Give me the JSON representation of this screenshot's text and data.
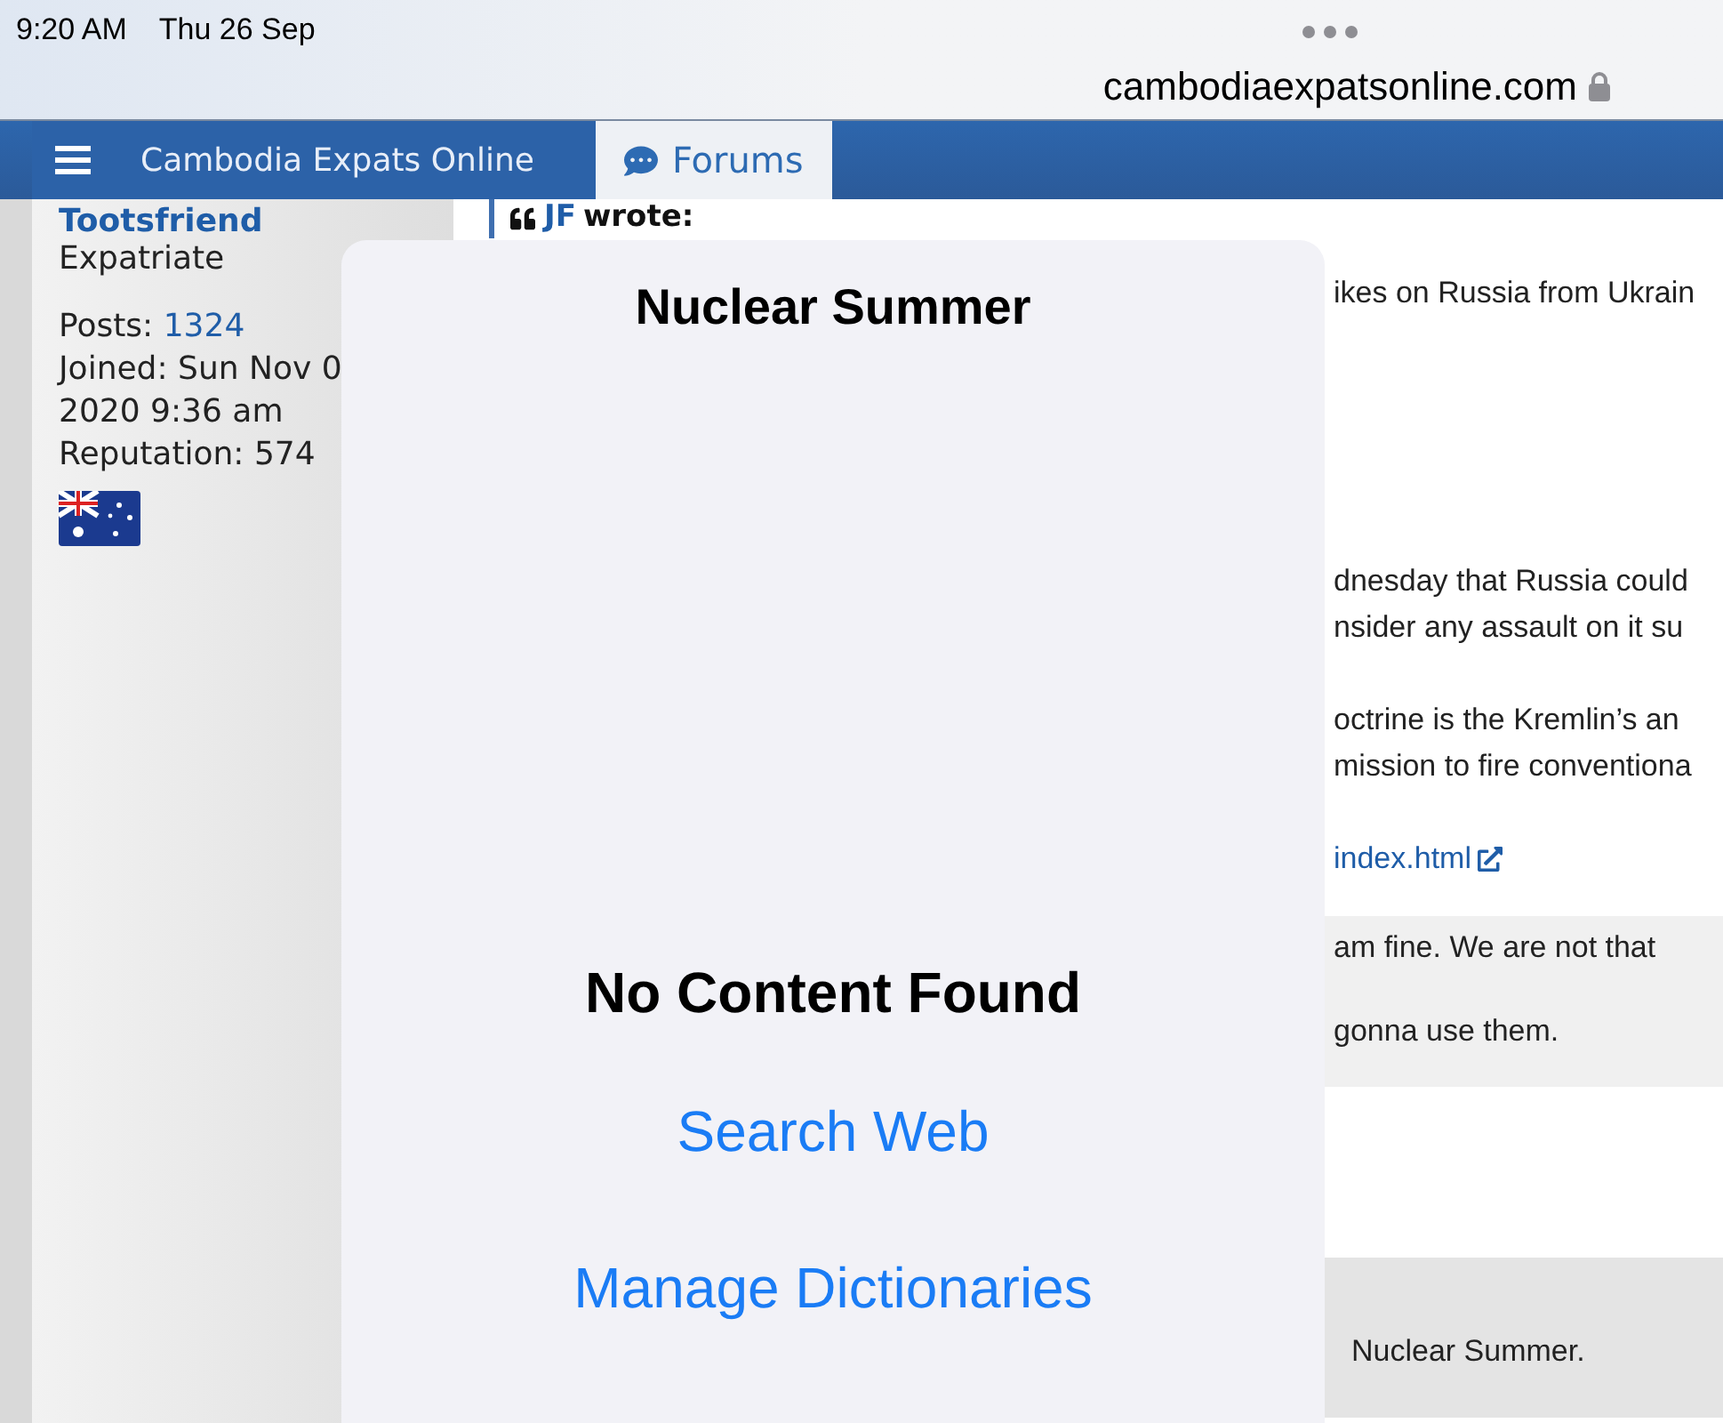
{
  "status_bar": {
    "time": "9:20 AM",
    "date": "Thu 26 Sep"
  },
  "address_bar": {
    "url": "cambodiaexpatsonline.com",
    "secure": true
  },
  "nav": {
    "site_title": "Cambodia Expats Online",
    "tabs": [
      {
        "label": "Forums",
        "selected": true
      }
    ]
  },
  "profile": {
    "username": "Tootsfriend",
    "rank": "Expatriate",
    "posts_label": "Posts:",
    "posts": "1324",
    "joined": "Joined: Sun Nov 0",
    "joined_time": "2020 9:36 am",
    "reputation": "Reputation: 574"
  },
  "quote": {
    "author": "JF",
    "wrote": "wrote:"
  },
  "post_lines": [
    {
      "kind": "text",
      "text": "ikes on Russia from Ukrain"
    },
    {
      "kind": "text",
      "text": "dnesday that Russia could"
    },
    {
      "kind": "text",
      "text": "nsider any assault on it su"
    },
    {
      "kind": "text",
      "text": "octrine is the Kremlin’s an"
    },
    {
      "kind": "text",
      "text": "mission to fire conventiona"
    },
    {
      "kind": "link",
      "text": "index.html"
    },
    {
      "kind": "quoted",
      "text": "am fine. We are not that"
    },
    {
      "kind": "quoted",
      "text": "gonna use them."
    }
  ],
  "reply": {
    "text": "Nuclear Summer."
  },
  "popover": {
    "title": "Nuclear Summer",
    "message": "No Content Found",
    "actions": [
      "Search Web",
      "Manage Dictionaries"
    ]
  }
}
